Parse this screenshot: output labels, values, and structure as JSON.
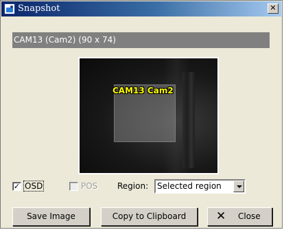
{
  "window": {
    "title": "Snapshot",
    "close_glyph": "✕"
  },
  "header": {
    "camera_info": "CAM13 (Cam2) (90 x 74)"
  },
  "preview": {
    "overlay_label": "CAM13 Cam2"
  },
  "options": {
    "osd": {
      "label": "OSD",
      "checked": true,
      "check_glyph": "✓"
    },
    "pos": {
      "label": "POS",
      "checked": false,
      "enabled": false
    },
    "region_label": "Region:",
    "region_value": "Selected region"
  },
  "buttons": {
    "save": "Save Image",
    "copy": "Copy to Clipboard",
    "close": "Close",
    "close_icon": "✕"
  },
  "colors": {
    "title_bar_start": "#0a246a",
    "header_bar_bg": "#808080",
    "overlay_text": "#ffff00"
  }
}
